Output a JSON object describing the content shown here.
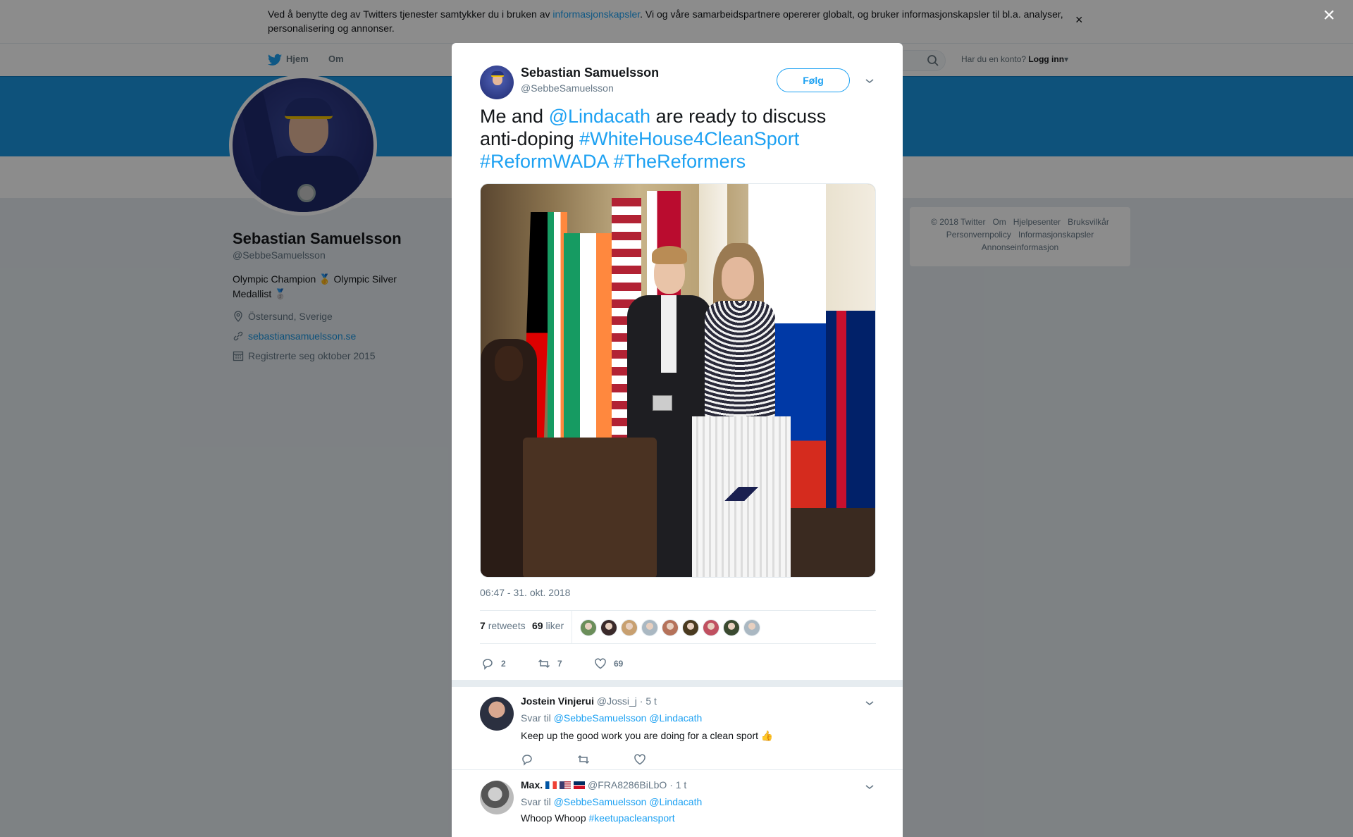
{
  "cookie_banner": {
    "text_before": "Ved å benytte deg av Twitters tjenester samtykker du i bruken av ",
    "link": "informasjonskapsler",
    "text_after": ". Vi og våre samarbeidspartnere opererer globalt, og bruker informasjonskapsler til bl.a. analyser, personalisering og annonser.",
    "close": "×"
  },
  "nav": {
    "home": "Hjem",
    "about": "Om",
    "account_prompt": "Har du en konto?",
    "login": "Logg inn"
  },
  "profile": {
    "name": "Sebastian Samuelsson",
    "handle": "@SebbeSamuelsson",
    "bio": "Olympic Champion 🥇 Olympic Silver Medallist 🥈",
    "location": "Östersund, Sverige",
    "website": "sebastiansamuelsson.se",
    "joined": "Registrerte seg oktober 2015"
  },
  "footer": {
    "items": [
      "© 2018 Twitter",
      "Om",
      "Hjelpesenter",
      "Bruksvilkår",
      "Personvernpolicy",
      "Informasjonskapsler",
      "Annonseinformasjon"
    ]
  },
  "modal": {
    "close": "×",
    "author_name": "Sebastian Samuelsson",
    "author_handle": "@SebbeSamuelsson",
    "follow_label": "Følg",
    "tweet": {
      "part1": "Me and ",
      "mention": "@Lindacath",
      "part2": " are ready to discuss anti-doping ",
      "tag1": "#WhiteHouse4CleanSport",
      "tag2": "#ReformWADA",
      "tag3": "#TheReformers"
    },
    "timestamp": "06:47 - 31. okt. 2018",
    "retweets_count": "7",
    "retweets_label": "retweets",
    "likes_count": "69",
    "likes_label": "liker",
    "liker_colors": [
      "#6b8e5a",
      "#3a2a2a",
      "#c8a070",
      "#aab8c2",
      "#b5725a",
      "#4a3a20",
      "#c05060",
      "#3a4a30",
      "#aab8c2"
    ],
    "actions": {
      "reply_count": "2",
      "retweet_count": "7",
      "like_count": "69"
    }
  },
  "replies": [
    {
      "name": "Jostein Vinjerui",
      "handle": "@Jossi_j",
      "time": "· 5 t",
      "reply_prefix": "Svar til ",
      "reply_to_1": "@SebbeSamuelsson",
      "reply_to_2": "@Lindacath",
      "text": "Keep up the good work you are doing for a clean sport 👍"
    },
    {
      "name": "Max.",
      "handle": "@FRA8286BiLbO",
      "time": "· 1 t",
      "reply_prefix": "Svar til ",
      "reply_to_1": "@SebbeSamuelsson",
      "reply_to_2": "@Lindacath",
      "text_before": "Whoop Whoop ",
      "text_tag": "#keetupacleansport"
    }
  ]
}
